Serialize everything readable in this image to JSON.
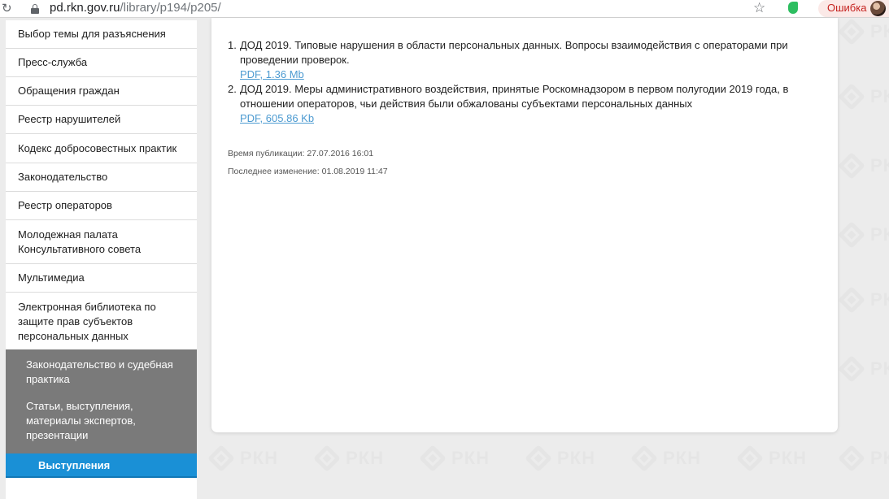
{
  "browser": {
    "url_host": "pd.rkn.gov.ru",
    "url_path": "/library/p194/p205/",
    "error_label": "Ошибка",
    "icons": [
      "reload-icon",
      "lock-icon",
      "star-icon",
      "evernote-icon",
      "avatar"
    ]
  },
  "watermark": {
    "text": "РКН"
  },
  "sidebar": {
    "items": [
      "Выбор темы для разъяснения",
      "Пресс-служба",
      "Обращения граждан",
      "Реестр нарушителей",
      "Кодекс добросовестных практик",
      "Законодательство",
      "Реестр операторов",
      "Молодежная палата Консультативного совета",
      "Мультимедиа",
      "Электронная библиотека по защите прав субъектов персональных данных"
    ],
    "subitems": [
      "Законодательство и судебная практика",
      "Статьи, выступления, материалы экспертов, презентации"
    ],
    "current": "Выступления"
  },
  "content": {
    "documents": [
      {
        "number": "1.",
        "title": "ДОД 2019. Типовые нарушения в области персональных данных. Вопросы взаимодействия с операторами при проведении проверок.",
        "link": "PDF, 1.36 Mb"
      },
      {
        "number": "2.",
        "title": "ДОД 2019. Меры административного воздействия, принятые Роскомнадзором в первом полугодии 2019 года, в отношении операторов, чьи действия были обжалованы субъектами персональных данных",
        "link": "PDF, 605.86 Kb"
      }
    ],
    "published": "Время публикации: 27.07.2016 16:01",
    "modified": "Последнее изменение: 01.08.2019 11:47"
  },
  "colors": {
    "accent": "#1a90d6",
    "subnav_bg": "#7a7a7a",
    "link": "#4d9bd1",
    "error_bg": "#fbe9e7"
  }
}
